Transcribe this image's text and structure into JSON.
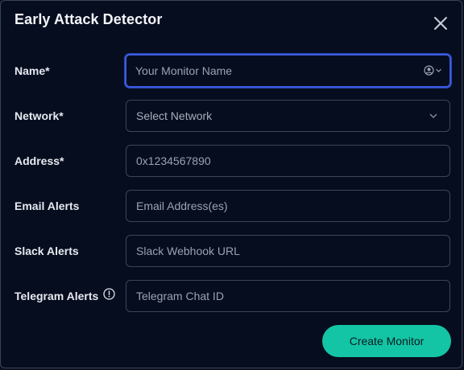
{
  "dialog": {
    "title": "Early Attack Detector",
    "close_icon": "close-icon"
  },
  "form": {
    "name": {
      "label": "Name*",
      "placeholder": "Your Monitor Name",
      "value": ""
    },
    "network": {
      "label": "Network*",
      "placeholder": "Select Network"
    },
    "address": {
      "label": "Address*",
      "placeholder": "0x1234567890",
      "value": ""
    },
    "email": {
      "label": "Email Alerts",
      "placeholder": "Email Address(es)",
      "value": ""
    },
    "slack": {
      "label": "Slack Alerts",
      "placeholder": "Slack Webhook URL",
      "value": ""
    },
    "telegram": {
      "label": "Telegram Alerts",
      "placeholder": "Telegram Chat ID",
      "value": "",
      "info_icon": "info-icon"
    }
  },
  "actions": {
    "create_label": "Create Monitor"
  },
  "colors": {
    "background": "#060d1f",
    "accent": "#13c5a4",
    "focus": "#3b5bdb",
    "border": "#3c4658"
  }
}
